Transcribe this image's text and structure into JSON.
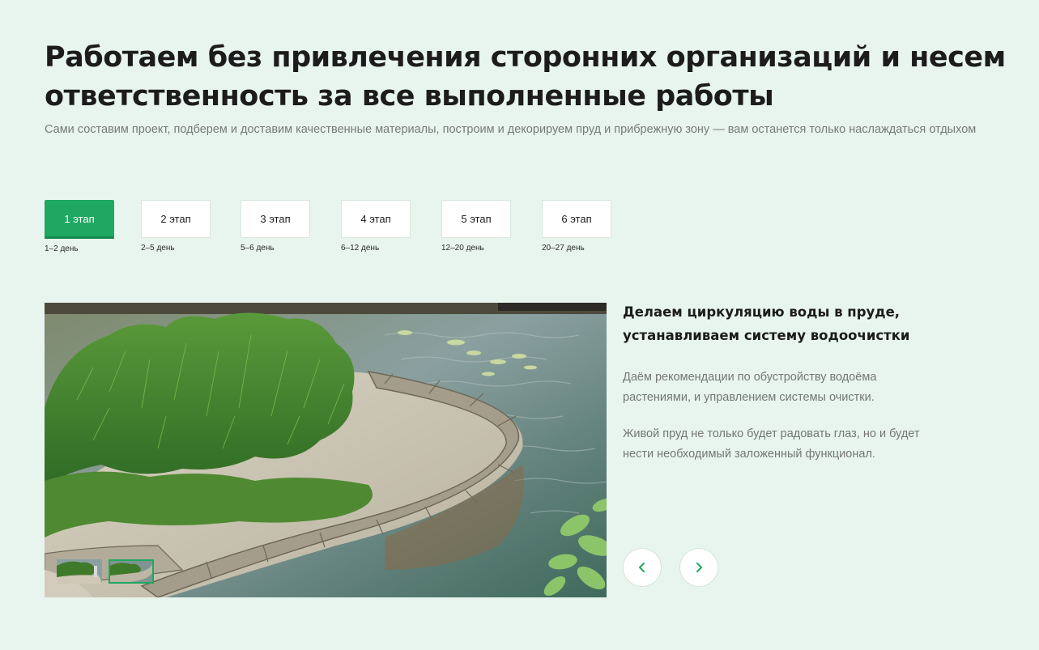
{
  "page": {
    "heading": "Работаем без привлечения сторонних организаций и несем ответственность за все выполненные работы",
    "subheading": "Сами составим проект, подберем и доставим качественные материалы, построим и декорируем пруд и прибрежную зону — вам останется только наслаждаться отдыхом"
  },
  "stages": [
    {
      "label": "1 этап",
      "days": "1–2 день",
      "active": true
    },
    {
      "label": "2 этап",
      "days": "2–5 день",
      "active": false
    },
    {
      "label": "3 этап",
      "days": "5–6 день",
      "active": false
    },
    {
      "label": "4 этап",
      "days": "6–12 день",
      "active": false
    },
    {
      "label": "5 этап",
      "days": "12–20 день",
      "active": false
    },
    {
      "label": "6 этап",
      "days": "20–27 день",
      "active": false
    }
  ],
  "stage_content": {
    "title": "Делаем циркуляцию воды в пруде, устанавливаем систему водоочистки",
    "paragraphs": [
      "Даём рекомендации по обустройству водоёма растениями, и управлением системы очистки.",
      "Живой пруд не только будет радовать глаз, но и будет нести необходимый заложенный функционал."
    ]
  },
  "gallery": {
    "thumbnails": 2,
    "active_thumbnail": 2
  },
  "navigation": {
    "prev_icon": "chevron-left-icon",
    "next_icon": "chevron-right-icon"
  },
  "colors": {
    "background": "#e8f5ee",
    "accent": "#1ea862",
    "text": "#1c1c1c",
    "muted_text": "#777a79"
  }
}
